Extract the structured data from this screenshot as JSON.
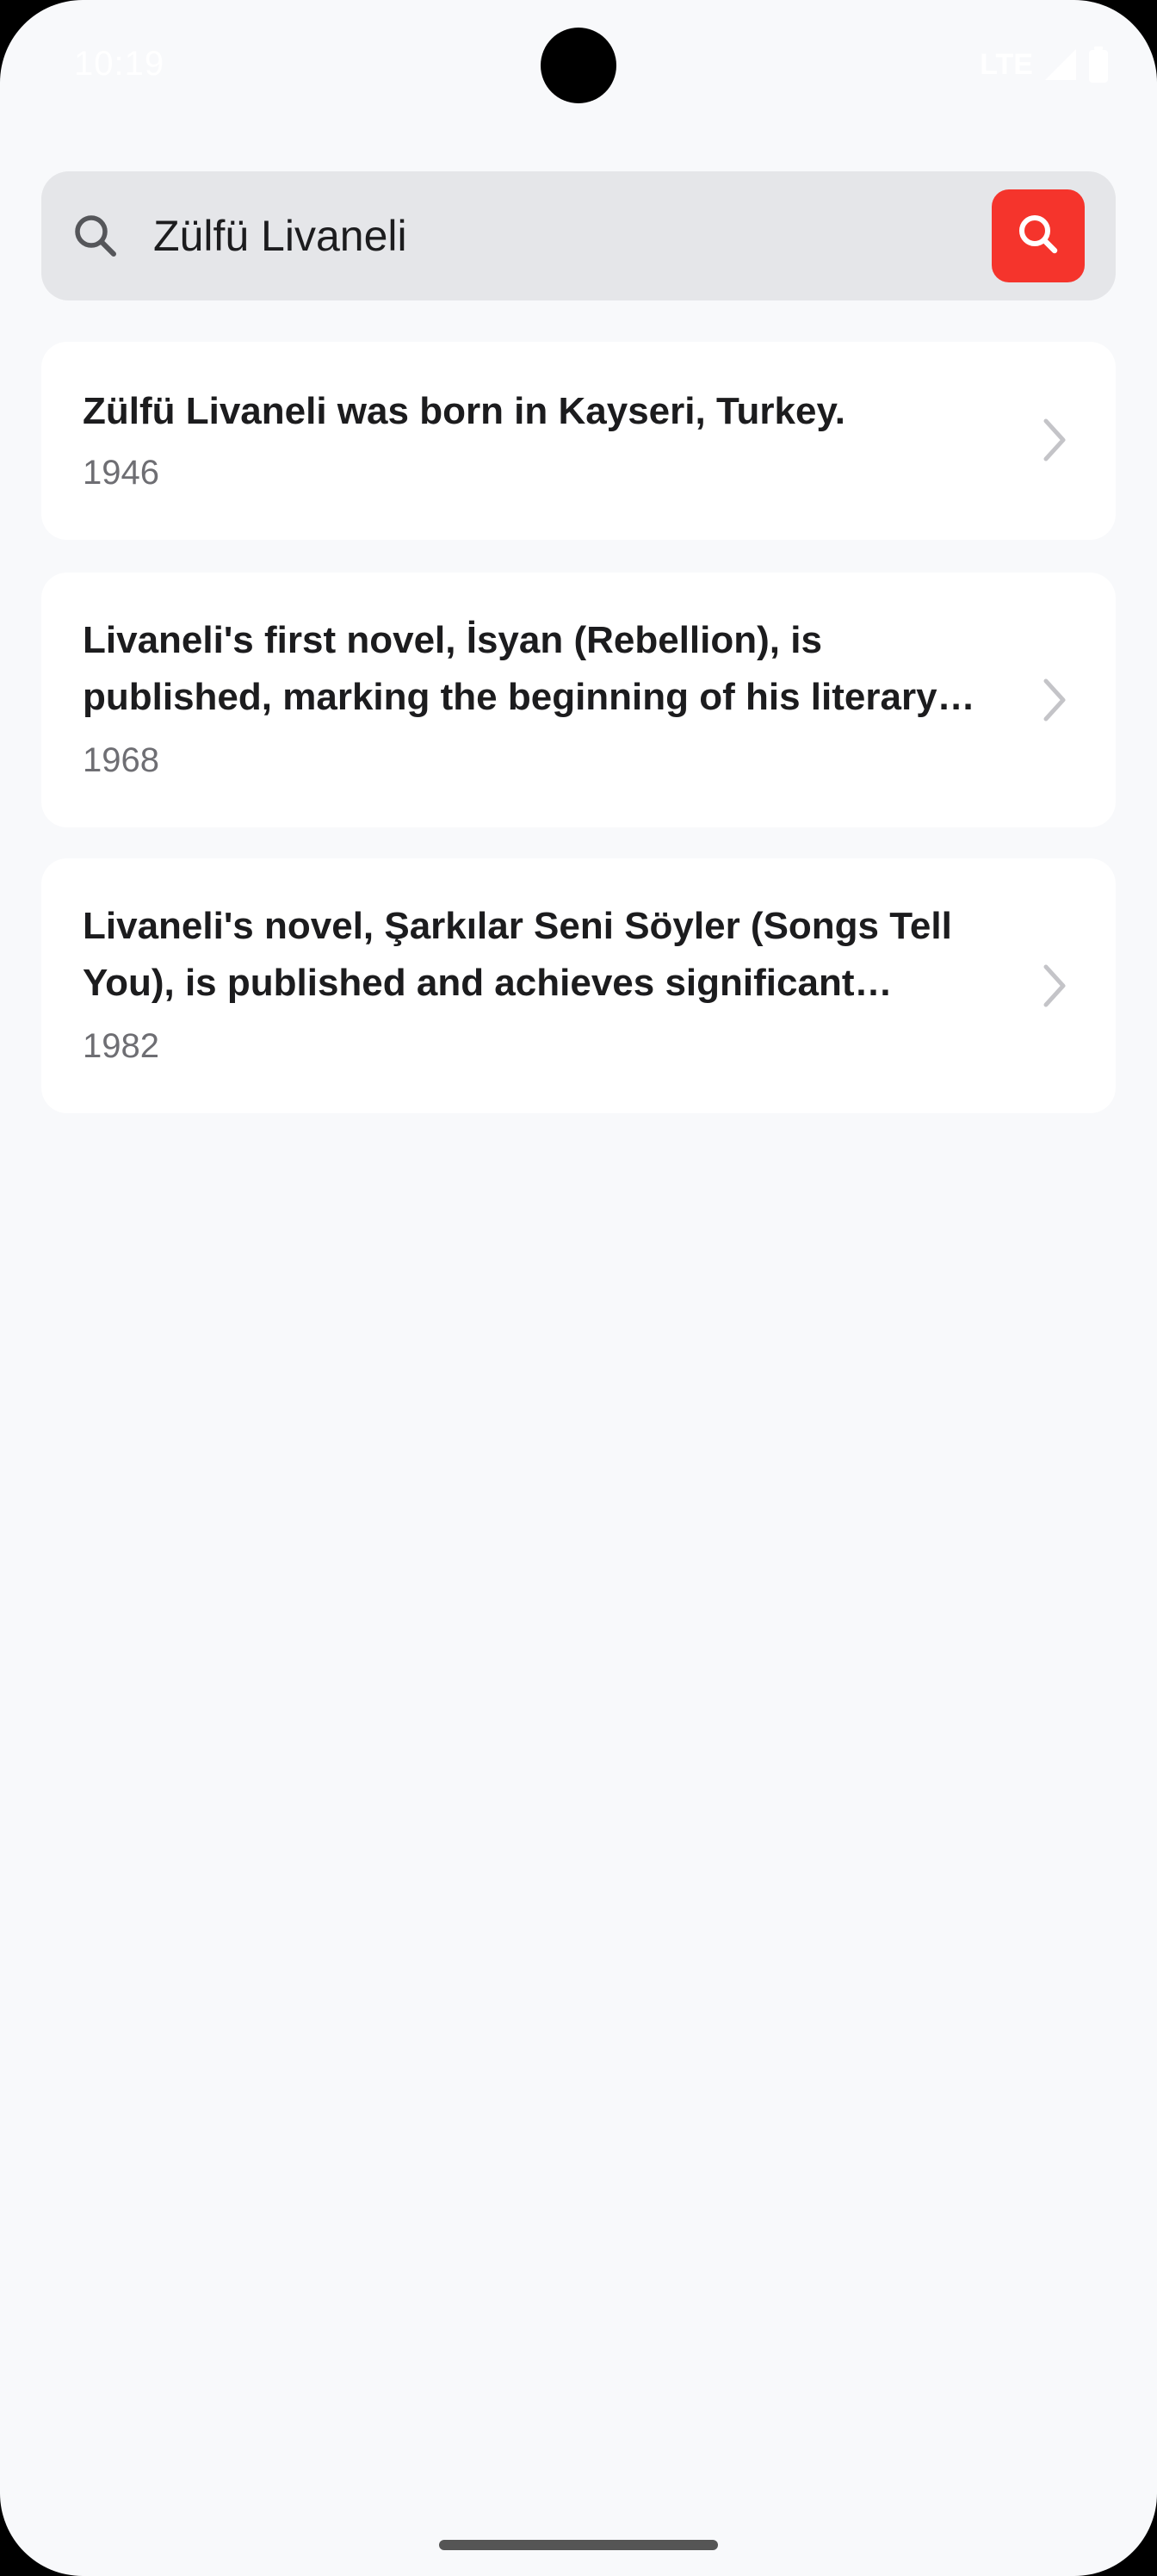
{
  "status_bar": {
    "time": "10:19",
    "network": "LTE"
  },
  "search": {
    "query": "Zülfü Livaneli",
    "colors": {
      "accent": "#f5342c",
      "field_bg": "#e5e6e9"
    }
  },
  "results": [
    {
      "title": "Zülfü Livaneli was born in Kayseri, Turkey.",
      "year": "1946"
    },
    {
      "title": "Livaneli's first novel, İsyan (Rebellion), is published, marking the beginning of his literary career.",
      "year": "1968"
    },
    {
      "title": "Livaneli's novel, Şarkılar Seni Söyler (Songs Tell You), is published and achieves significant success.",
      "year": "1982"
    }
  ],
  "icons": {
    "search_field": "search-icon",
    "search_button": "search-icon",
    "row_chevron": "chevron-right-icon"
  }
}
